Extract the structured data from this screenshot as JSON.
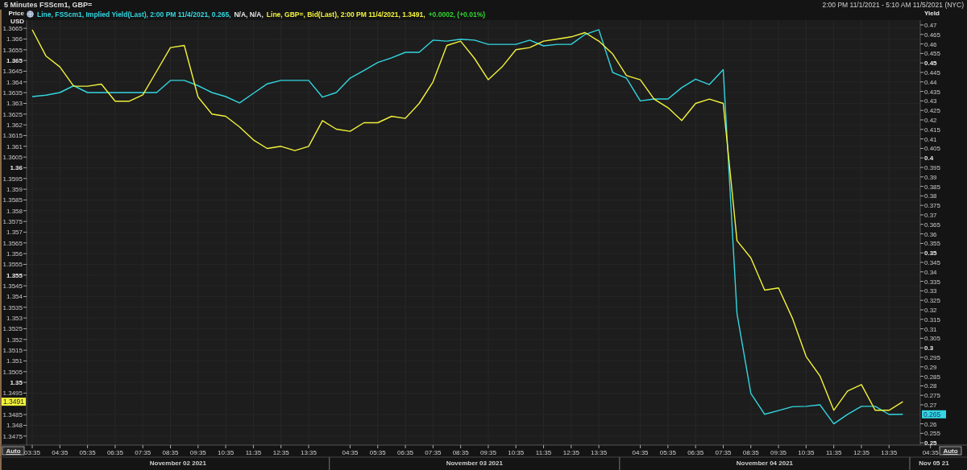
{
  "header": {
    "title": "5 Minutes FSScm1, GBP=",
    "range": "2:00 PM 11/1/2021 - 5:10 AM 11/5/2021 (NYC)"
  },
  "chart": {
    "legend": [
      {
        "text": "Line, FSScm1, Implied Yield(Last),  2:00 PM 11/4/2021, 0.265,",
        "color": "#33d6e0"
      },
      {
        "text": "N/A, N/A,",
        "color": "#e6e6e6"
      },
      {
        "text": "Line, GBP=, Bid(Last),  2:00 PM 11/4/2021, 1.3491,",
        "color": "#f2f23c"
      },
      {
        "text": "+0.0002, (+0.01%)",
        "color": "#33d633"
      }
    ],
    "axis_buttons": [
      "Auto",
      "Auto"
    ],
    "last_values": [
      "0.265",
      "1.3491"
    ],
    "chart_data": {
      "type": "line",
      "grid": true,
      "ylabel": "Price USD",
      "y2label": "Yield",
      "ylim": [
        1.34708,
        1.36688
      ],
      "y2lim": [
        0.24881,
        0.47254
      ],
      "yticks": [
        1.3475,
        1.348,
        1.3485,
        1.3495,
        1.35,
        1.3505,
        1.351,
        1.3515,
        1.352,
        1.3525,
        1.353,
        1.3535,
        1.354,
        1.3545,
        1.355,
        1.3555,
        1.356,
        1.3565,
        1.357,
        1.3575,
        1.358,
        1.3585,
        1.359,
        1.3595,
        1.36,
        1.3605,
        1.361,
        1.3615,
        1.362,
        1.3625,
        1.363,
        1.3635,
        1.364,
        1.3645,
        1.365,
        1.3655,
        1.366,
        1.3665
      ],
      "y2ticks": [
        0.25,
        0.255,
        0.26,
        0.27,
        0.275,
        0.28,
        0.285,
        0.29,
        0.295,
        0.3,
        0.305,
        0.31,
        0.315,
        0.32,
        0.325,
        0.33,
        0.335,
        0.34,
        0.345,
        0.35,
        0.355,
        0.36,
        0.365,
        0.37,
        0.375,
        0.38,
        0.385,
        0.39,
        0.395,
        0.4,
        0.405,
        0.41,
        0.415,
        0.42,
        0.425,
        0.43,
        0.435,
        0.44,
        0.445,
        0.45,
        0.455,
        0.46,
        0.465,
        0.47
      ],
      "categories": [
        "03:35",
        null,
        "04:35",
        null,
        "05:35",
        null,
        "06:35",
        null,
        "07:35",
        null,
        "08:35",
        null,
        "09:35",
        null,
        "10:35",
        null,
        "11:35",
        null,
        "12:35",
        null,
        "13:35",
        null,
        null,
        "04:35",
        null,
        "05:35",
        null,
        "06:35",
        null,
        "07:35",
        null,
        "08:35",
        null,
        "09:35",
        null,
        "10:35",
        null,
        "11:35",
        null,
        "12:35",
        null,
        "13:35",
        null,
        null,
        "04:35",
        null,
        "05:35",
        null,
        "06:35",
        null,
        "07:35",
        null,
        "08:35",
        null,
        "09:35",
        null,
        "10:35",
        null,
        "11:35",
        null,
        "12:35",
        null,
        "13:35",
        null,
        null,
        "04:35",
        null
      ],
      "annotations": [
        "November 02 2021",
        "November 03 2021",
        "November 04 2021",
        "Nov 05 21"
      ],
      "series": [
        {
          "color": "#33d6e0",
          "axis": "y2",
          "values": [
            0.4323,
            0.433,
            0.4344,
            0.438,
            0.4344,
            0.4344,
            0.4344,
            0.4344,
            0.4344,
            0.4344,
            0.4408,
            0.4408,
            0.438,
            0.4344,
            0.4323,
            0.429,
            0.434,
            0.439,
            0.4408,
            0.4408,
            0.4408,
            0.432,
            0.4344,
            0.442,
            0.446,
            0.4502,
            0.4527,
            0.4556,
            0.4556,
            0.462,
            0.4615,
            0.4625,
            0.462,
            0.4598,
            0.4598,
            0.4598,
            0.462,
            0.459,
            0.4598,
            0.4598,
            0.465,
            0.4675,
            0.445,
            0.442,
            0.43,
            0.431,
            0.431,
            0.437,
            0.4415,
            0.4386,
            0.4465,
            0.3179,
            0.276,
            0.265,
            0.267,
            0.269,
            0.2692,
            0.27,
            0.26,
            0.265,
            0.2692,
            0.2692,
            0.2649,
            0.265,
            null,
            null,
            null
          ]
        },
        {
          "color": "#f2f23c",
          "values": [
            1.36643,
            1.3652,
            1.3647,
            1.3638,
            1.3638,
            1.3639,
            1.3631,
            1.3631,
            1.3634,
            1.3645,
            1.3656,
            1.3657,
            1.3633,
            1.3625,
            1.3624,
            1.3619,
            1.3613,
            1.3609,
            1.361,
            1.3608,
            1.361,
            1.3622,
            1.3618,
            1.3617,
            1.3621,
            1.3621,
            1.3624,
            1.3623,
            1.363,
            1.364,
            1.3657,
            1.3659,
            1.3651,
            1.3641,
            1.3647,
            1.3655,
            1.3656,
            1.3659,
            1.366,
            1.3661,
            1.3663,
            1.3659,
            1.3653,
            1.3643,
            1.3641,
            1.3632,
            1.3628,
            1.3622,
            1.363,
            1.3632,
            1.363,
            1.3566,
            1.3558,
            1.3543,
            1.3544,
            1.353,
            1.3512,
            1.3503,
            1.3487,
            1.3496,
            1.3499,
            1.3487,
            1.3487,
            1.3491,
            null,
            null,
            null
          ]
        }
      ]
    }
  }
}
